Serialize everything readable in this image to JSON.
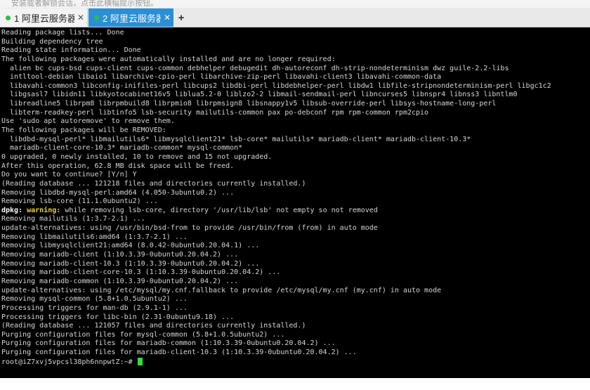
{
  "hint_bar": {
    "text": "安装或者解锁会话，点击此横幅提示按钮。"
  },
  "tabs": [
    {
      "number": "1",
      "title": "阿里云服务器",
      "status_color": "#2dbd4a",
      "active": false
    },
    {
      "number": "2",
      "title": "阿里云服务器",
      "status_color": "#2dbd4a",
      "active": true
    }
  ],
  "add_tab_label": "+",
  "colors": {
    "active_tab": "#2b8fd6",
    "terminal_bg": "#000000",
    "cursor": "#2fe03a",
    "warning": "#e6d32b"
  },
  "terminal": {
    "lines": [
      "Reading package lists... Done",
      "Building dependency tree",
      "Reading state information... Done",
      "The following packages were automatically installed and are no longer required:",
      "  alien bc cups-bsd cups-client cups-common debhelper debugedit dh-autoreconf dh-strip-nondeterminism dwz guile-2.2-libs",
      "  intltool-debian libaio1 libarchive-cpio-perl libarchive-zip-perl libavahi-client3 libavahi-common-data",
      "  libavahi-common3 libconfig-inifiles-perl libcups2 libdbi-perl libdebhelper-perl libdw1 libfile-stripnondeterminism-perl libgc1c2",
      "  libgsasl7 libidn11 libkyotocabinet16v5 liblua5.2-0 liblzo2-2 libmail-sendmail-perl libncurses5 libnspr4 libnss3 libntlm0",
      "  libreadline5 librpm8 librpmbuild8 librpmio8 librpmsign8 libsnappy1v5 libsub-override-perl libsys-hostname-long-perl",
      "  libterm-readkey-perl libtinfo5 lsb-security mailutils-common pax po-debconf rpm rpm-common rpm2cpio",
      "Use 'sudo apt autoremove' to remove them.",
      "The following packages will be REMOVED:",
      "  libdbd-mysql-perl* libmailutils6* libmysqlclient21* lsb-core* mailutils* mariadb-client* mariadb-client-10.3*",
      "  mariadb-client-core-10.3* mariadb-common* mysql-common*",
      "0 upgraded, 0 newly installed, 10 to remove and 15 not upgraded.",
      "After this operation, 62.8 MB disk space will be freed.",
      "Do you want to continue? [Y/n] Y",
      "(Reading database ... 121218 files and directories currently installed.)",
      "Removing libdbd-mysql-perl:amd64 (4.050-3ubuntu0.2) ...",
      "Removing lsb-core (11.1.0ubuntu2) ...",
      "__DPKG_WARNING__",
      "Removing mailutils (1:3.7-2.1) ...",
      "update-alternatives: using /usr/bin/bsd-from to provide /usr/bin/from (from) in auto mode",
      "Removing libmailutils6:amd64 (1:3.7-2.1) ...",
      "Removing libmysqlclient21:amd64 (8.0.42-0ubuntu0.20.04.1) ...",
      "Removing mariadb-client (1:10.3.39-0ubuntu0.20.04.2) ...",
      "Removing mariadb-client-10.3 (1:10.3.39-0ubuntu0.20.04.2) ...",
      "Removing mariadb-client-core-10.3 (1:10.3.39-0ubuntu0.20.04.2) ...",
      "Removing mariadb-common (1:10.3.39-0ubuntu0.20.04.2) ...",
      "update-alternatives: using /etc/mysql/my.cnf.fallback to provide /etc/mysql/my.cnf (my.cnf) in auto mode",
      "Removing mysql-common (5.8+1.0.5ubuntu2) ...",
      "Processing triggers for man-db (2.9.1-1) ...",
      "Processing triggers for libc-bin (2.31-0ubuntu9.18) ...",
      "(Reading database ... 121057 files and directories currently installed.)",
      "Purging configuration files for mysql-common (5.8+1.0.5ubuntu2) ...",
      "Purging configuration files for mariadb-common (1:10.3.39-0ubuntu0.20.04.2) ...",
      "Purging configuration files for mariadb-client-10.3 (1:10.3.39-0ubuntu0.20.04.2) ..."
    ],
    "dpkg_warning": {
      "prefix": "dpkg: ",
      "label": "warning:",
      "message": " while removing lsb-core, directory '/usr/lib/lsb' not empty so not removed"
    },
    "prompt": "root@iZ7xvj5vpcsl38ph6nnpwtZ:~# "
  }
}
